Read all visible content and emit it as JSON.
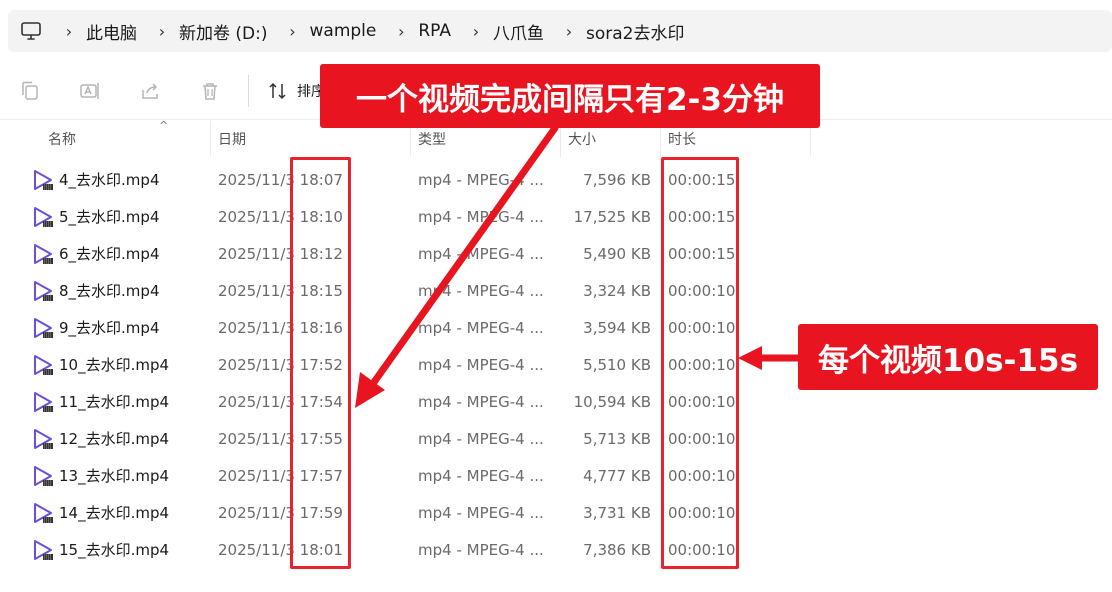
{
  "breadcrumb": {
    "root_icon": "computer-icon",
    "items": [
      "此电脑",
      "新加卷 (D:)",
      "wample",
      "RPA",
      "八爪鱼",
      "sora2去水印"
    ]
  },
  "toolbar": {
    "icons": [
      "copy-icon",
      "rename-icon",
      "share-icon",
      "delete-icon"
    ],
    "sort_label": "排序"
  },
  "columns": {
    "name": "名称",
    "date": "日期",
    "type": "类型",
    "size": "大小",
    "duration": "时长"
  },
  "files": [
    {
      "name": "4_去水印.mp4",
      "date": "2025/11/3 18:07",
      "type": "mp4 - MPEG-4 ...",
      "size": "7,596 KB",
      "duration": "00:00:15"
    },
    {
      "name": "5_去水印.mp4",
      "date": "2025/11/3 18:10",
      "type": "mp4 - MPEG-4 ...",
      "size": "17,525 KB",
      "duration": "00:00:15"
    },
    {
      "name": "6_去水印.mp4",
      "date": "2025/11/3 18:12",
      "type": "mp4 - MPEG-4 ...",
      "size": "5,490 KB",
      "duration": "00:00:15"
    },
    {
      "name": "8_去水印.mp4",
      "date": "2025/11/3 18:15",
      "type": "mp4 - MPEG-4 ...",
      "size": "3,324 KB",
      "duration": "00:00:10"
    },
    {
      "name": "9_去水印.mp4",
      "date": "2025/11/3 18:16",
      "type": "mp4 - MPEG-4 ...",
      "size": "3,594 KB",
      "duration": "00:00:10"
    },
    {
      "name": "10_去水印.mp4",
      "date": "2025/11/3 17:52",
      "type": "mp4 - MPEG-4 ...",
      "size": "5,510 KB",
      "duration": "00:00:10"
    },
    {
      "name": "11_去水印.mp4",
      "date": "2025/11/3 17:54",
      "type": "mp4 - MPEG-4 ...",
      "size": "10,594 KB",
      "duration": "00:00:10"
    },
    {
      "name": "12_去水印.mp4",
      "date": "2025/11/3 17:55",
      "type": "mp4 - MPEG-4 ...",
      "size": "5,713 KB",
      "duration": "00:00:10"
    },
    {
      "name": "13_去水印.mp4",
      "date": "2025/11/3 17:57",
      "type": "mp4 - MPEG-4 ...",
      "size": "4,777 KB",
      "duration": "00:00:10"
    },
    {
      "name": "14_去水印.mp4",
      "date": "2025/11/3 17:59",
      "type": "mp4 - MPEG-4 ...",
      "size": "3,731 KB",
      "duration": "00:00:10"
    },
    {
      "name": "15_去水印.mp4",
      "date": "2025/11/3 18:01",
      "type": "mp4 - MPEG-4 ...",
      "size": "7,386 KB",
      "duration": "00:00:10"
    }
  ],
  "annotations": {
    "top_banner": "一个视频完成间隔只有2-3分钟",
    "right_banner": "每个视频10s-15s",
    "color": "#e8141f"
  },
  "colors": {
    "file_icon": "#6b4fd8",
    "highlight": "#e8232d"
  }
}
